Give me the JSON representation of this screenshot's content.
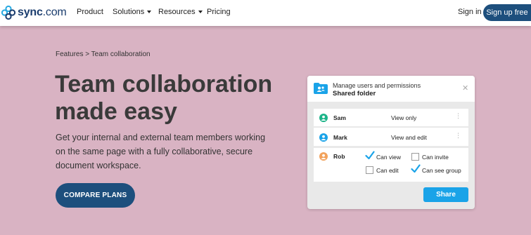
{
  "brand": {
    "name": "sync",
    "suffix": ".com"
  },
  "nav": {
    "items": [
      {
        "label": "Product"
      },
      {
        "label": "Solutions"
      },
      {
        "label": "Resources"
      },
      {
        "label": "Pricing"
      }
    ],
    "signin_label": "Sign in",
    "signup_label": "Sign up free"
  },
  "hero": {
    "breadcrumb": "Features > Team collaboration",
    "title_line1": "Team collaboration",
    "title_line2": "made easy",
    "description": "Get your internal and external team members working on the same page with a fully collaborative, secure document workspace.",
    "cta_label": "COMPARE PLANS"
  },
  "dialog": {
    "subtitle": "Manage users and permissions",
    "title": "Shared folder",
    "close_glyph": "✕",
    "users": [
      {
        "name": "Sam",
        "permission": "View only",
        "avatar_color": "#1db489"
      },
      {
        "name": "Mark",
        "permission": "View and edit",
        "avatar_color": "#1aa3e8"
      },
      {
        "name": "Rob",
        "avatar_color": "#f2a25c",
        "options": [
          {
            "label": "Can view",
            "checked": true
          },
          {
            "label": "Can invite",
            "checked": false
          },
          {
            "label": "Can edit",
            "checked": false
          },
          {
            "label": "Can see group",
            "checked": true
          }
        ]
      }
    ],
    "share_label": "Share"
  },
  "colors": {
    "background": "#d9b3c3",
    "brand_navy": "#1d4f7d",
    "accent_blue": "#1aa3e8",
    "check_blue": "#1aa3e8"
  },
  "icons": [
    "sync-logo-icon",
    "folder-users-icon",
    "user-icon",
    "kebab-icon",
    "checkmark-icon",
    "close-icon",
    "caret-down-icon"
  ]
}
